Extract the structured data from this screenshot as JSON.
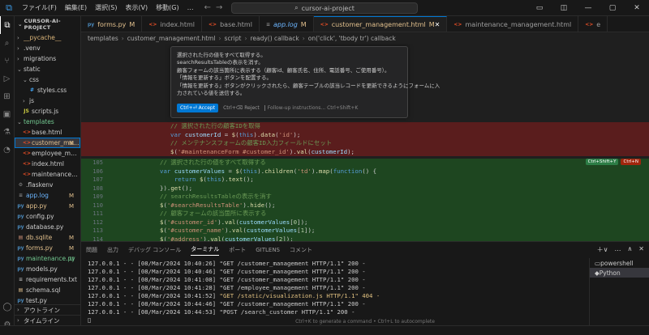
{
  "titlebar": {
    "menus": [
      "ファイル(F)",
      "編集(E)",
      "選択(S)",
      "表示(V)",
      "移動(G)"
    ],
    "more": "…",
    "search": "cursor-ai-project"
  },
  "sidebar": {
    "header": "CURSOR-AI-PROJECT",
    "items": [
      {
        "label": "__pycache__",
        "kind": "folder",
        "indent": 0,
        "open": false,
        "color": "#dcb67a",
        "badge": "",
        "badge_color": ""
      },
      {
        "label": ".venv",
        "kind": "folder",
        "indent": 0,
        "open": false,
        "color": "#ccc",
        "badge": "",
        "badge_color": ""
      },
      {
        "label": "migrations",
        "kind": "folder",
        "indent": 0,
        "open": false,
        "color": "#ccc",
        "badge": "",
        "badge_color": ""
      },
      {
        "label": "static",
        "kind": "folder",
        "indent": 0,
        "open": true,
        "color": "#ccc",
        "badge": "",
        "badge_color": ""
      },
      {
        "label": "css",
        "kind": "folder",
        "indent": 1,
        "open": true,
        "color": "#ccc",
        "badge": "",
        "badge_color": ""
      },
      {
        "label": "styles.css",
        "kind": "css",
        "indent": 2,
        "open": false,
        "color": "#ccc",
        "badge": "",
        "badge_color": ""
      },
      {
        "label": "js",
        "kind": "folder",
        "indent": 1,
        "open": false,
        "color": "#ccc",
        "badge": "",
        "badge_color": ""
      },
      {
        "label": "scripts.js",
        "kind": "js",
        "indent": 1,
        "open": false,
        "color": "#ccc",
        "badge": "",
        "badge_color": ""
      },
      {
        "label": "templates",
        "kind": "folder",
        "indent": 0,
        "open": true,
        "color": "#73c991",
        "badge": "",
        "badge_color": ""
      },
      {
        "label": "base.html",
        "kind": "html",
        "indent": 1,
        "open": false,
        "color": "#ccc",
        "badge": "",
        "badge_color": ""
      },
      {
        "label": "customer_man...",
        "kind": "html",
        "indent": 1,
        "open": false,
        "color": "#e2c08d",
        "badge": "M",
        "badge_color": "#e2c08d",
        "selected": true
      },
      {
        "label": "employee_manage...",
        "kind": "html",
        "indent": 1,
        "open": false,
        "color": "#ccc",
        "badge": "",
        "badge_color": ""
      },
      {
        "label": "index.html",
        "kind": "html",
        "indent": 1,
        "open": false,
        "color": "#ccc",
        "badge": "",
        "badge_color": ""
      },
      {
        "label": "maintenance_mana...",
        "kind": "html",
        "indent": 1,
        "open": false,
        "color": "#ccc",
        "badge": "",
        "badge_color": ""
      },
      {
        "label": ".flaskenv",
        "kind": "env",
        "indent": 0,
        "open": false,
        "color": "#ccc",
        "badge": "",
        "badge_color": ""
      },
      {
        "label": "app.log",
        "kind": "log",
        "indent": 0,
        "open": false,
        "color": "#6cb6ff",
        "badge": "M",
        "badge_color": "#e2c08d"
      },
      {
        "label": "app.py",
        "kind": "py",
        "indent": 0,
        "open": false,
        "color": "#e2c08d",
        "badge": "M",
        "badge_color": "#e2c08d"
      },
      {
        "label": "config.py",
        "kind": "py",
        "indent": 0,
        "open": false,
        "color": "#ccc",
        "badge": "",
        "badge_color": ""
      },
      {
        "label": "database.py",
        "kind": "py",
        "indent": 0,
        "open": false,
        "color": "#ccc",
        "badge": "",
        "badge_color": ""
      },
      {
        "label": "db.sqlite",
        "kind": "db",
        "indent": 0,
        "open": false,
        "color": "#e2c08d",
        "badge": "M",
        "badge_color": "#e2c08d"
      },
      {
        "label": "forms.py",
        "kind": "py",
        "indent": 0,
        "open": false,
        "color": "#e2c08d",
        "badge": "M",
        "badge_color": "#e2c08d"
      },
      {
        "label": "maintenance.py",
        "kind": "py",
        "indent": 0,
        "open": false,
        "color": "#73c991",
        "badge": "U",
        "badge_color": "#73c991"
      },
      {
        "label": "models.py",
        "kind": "py",
        "indent": 0,
        "open": false,
        "color": "#ccc",
        "badge": "",
        "badge_color": ""
      },
      {
        "label": "requirements.txt",
        "kind": "txt",
        "indent": 0,
        "open": false,
        "color": "#ccc",
        "badge": "",
        "badge_color": ""
      },
      {
        "label": "schema.sql",
        "kind": "sql",
        "indent": 0,
        "open": false,
        "color": "#ccc",
        "badge": "",
        "badge_color": ""
      },
      {
        "label": "test.py",
        "kind": "py",
        "indent": 0,
        "open": false,
        "color": "#ccc",
        "badge": "",
        "badge_color": ""
      }
    ],
    "outline": "アウトライン",
    "timeline": "タイムライン"
  },
  "tabs": [
    {
      "label": "forms.py",
      "badge": "M",
      "icon": "py",
      "active": false,
      "color": "#e2c08d"
    },
    {
      "label": "index.html",
      "badge": "",
      "icon": "html",
      "active": false,
      "color": "#9d9d9d"
    },
    {
      "label": "base.html",
      "badge": "",
      "icon": "html",
      "active": false,
      "color": "#9d9d9d"
    },
    {
      "label": "app.log",
      "badge": "M",
      "icon": "log",
      "active": false,
      "color": "#6cb6ff"
    },
    {
      "label": "customer_management.html",
      "badge": "M",
      "icon": "html",
      "active": true,
      "color": "#e2c08d"
    },
    {
      "label": "maintenance_management.html",
      "badge": "",
      "icon": "html",
      "active": false,
      "color": "#9d9d9d"
    },
    {
      "label": "e",
      "badge": "",
      "icon": "html",
      "active": false,
      "color": "#9d9d9d"
    }
  ],
  "breadcrumb": [
    "templates",
    "customer_management.html",
    "script",
    "ready() callback",
    "on('click', 'tbody tr') callback"
  ],
  "inline_chat": {
    "lines": [
      "選択された行の値をすべて取得する。",
      "searchResultsTableの表示を消す。",
      "顧客フォームの該当箇所に表示する（顧客id、顧客氏名、住所、電話番号、ご使用番号）。",
      "「情報を更新する」ボタンを配置する。",
      "「情報を更新する」ボタンがクリックされたら、顧客テーブルの該当レコードを更新できるようにフォームに入",
      "力されている値を送信する。"
    ],
    "accept": "Ctrl+⏎ Accept",
    "reject": "Ctrl+⌫ Reject",
    "followup": "Follow-up instructions... Ctrl+Shift+K"
  },
  "code": {
    "deleted": [
      "// 選択された行の顧客IDを取得",
      "var customerId = $(this).data('id');",
      "// メンテナンスフォームの顧客ID入力フィールドにセット",
      "$('#maintenanceForm #customer_id').val(customerId);"
    ],
    "added_numbers": [
      "105",
      "106",
      "107",
      "108",
      "109",
      "110",
      "111",
      "112",
      "113",
      "114"
    ],
    "badges": [
      "Ctrl+Shift+Y",
      "Ctrl+N"
    ]
  },
  "panel": {
    "tabs": [
      "問題",
      "出力",
      "デバッグ コンソール",
      "ターミナル",
      "ポート",
      "GITLENS",
      "コメント"
    ],
    "active_tab": "ターミナル",
    "tools": [
      "＋∨",
      "…",
      "∧",
      "✕"
    ],
    "terminal_lines": [
      {
        "t": "127.0.0.1 - - [08/Mar/2024 10:40:26] \"GET /customer_management HTTP/1.1\" 200 -",
        "hl": ""
      },
      {
        "t": "127.0.0.1 - - [08/Mar/2024 10:40:46] \"GET /customer_management HTTP/1.1\" 200 -",
        "hl": ""
      },
      {
        "t": "127.0.0.1 - - [08/Mar/2024 10:41:08] \"GET /customer_management HTTP/1.1\" 200 -",
        "hl": ""
      },
      {
        "t": "127.0.0.1 - - [08/Mar/2024 10:41:28] \"GET /employee_management HTTP/1.1\" 200 -",
        "hl": ""
      },
      {
        "t": "127.0.0.1 - - [08/Mar/2024 10:41:52] ",
        "hl": "\"GET /static/visualization.js HTTP/1.1\" 404 -"
      },
      {
        "t": "127.0.0.1 - - [08/Mar/2024 10:44:46] \"GET /customer_management HTTP/1.1\" 200 -",
        "hl": ""
      },
      {
        "t": "127.0.0.1 - - [08/Mar/2024 10:44:53] \"POST /search_customer HTTP/1.1\" 200 -",
        "hl": ""
      }
    ],
    "terminals": [
      "powershell",
      "Python"
    ],
    "hint": "Ctrl+K to generate a command • Ctrl+L to autocomplete"
  }
}
